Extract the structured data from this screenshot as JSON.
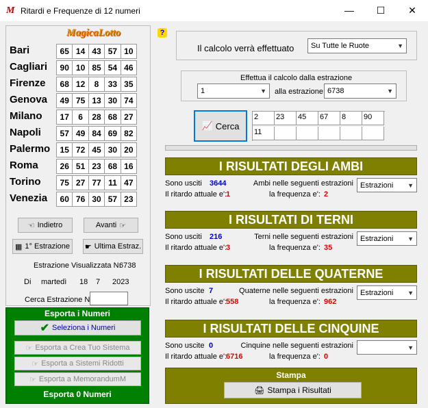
{
  "window": {
    "title": "Ritardi e Frequenze di 12 numeri",
    "icon": "magic-lotto-app-icon",
    "controls": [
      "—",
      "☐",
      "✕"
    ]
  },
  "logo": "MagicaLotto",
  "wheels": [
    {
      "name": "Bari",
      "numbers": [
        "65",
        "14",
        "43",
        "57",
        "10"
      ]
    },
    {
      "name": "Cagliari",
      "numbers": [
        "90",
        "10",
        "85",
        "54",
        "46"
      ]
    },
    {
      "name": "Firenze",
      "numbers": [
        "68",
        "12",
        "8",
        "33",
        "35"
      ]
    },
    {
      "name": "Genova",
      "numbers": [
        "49",
        "75",
        "13",
        "30",
        "74"
      ]
    },
    {
      "name": "Milano",
      "numbers": [
        "17",
        "6",
        "28",
        "68",
        "27"
      ]
    },
    {
      "name": "Napoli",
      "numbers": [
        "57",
        "49",
        "84",
        "69",
        "82"
      ]
    },
    {
      "name": "Palermo",
      "numbers": [
        "15",
        "72",
        "45",
        "30",
        "20"
      ]
    },
    {
      "name": "Roma",
      "numbers": [
        "26",
        "51",
        "23",
        "68",
        "16"
      ]
    },
    {
      "name": "Torino",
      "numbers": [
        "75",
        "27",
        "77",
        "11",
        "47"
      ]
    },
    {
      "name": "Venezia",
      "numbers": [
        "60",
        "76",
        "30",
        "57",
        "23"
      ]
    }
  ],
  "nav": {
    "back": "Indietro",
    "forward": "Avanti",
    "first": "1° Estrazione",
    "last": "Ultima Estraz.",
    "visualized_label": "Estrazione Visualizzata N:",
    "visualized_value": "6738",
    "di": "Di",
    "weekday": "martedì",
    "day": "18",
    "month": "7",
    "year": "2023",
    "search_label": "Cerca Estrazione N:",
    "search_value": ""
  },
  "export": {
    "title": "Esporta i Numeri",
    "select_btn": "Seleziona i Numeri",
    "btn1": "Esporta a Crea Tuo Sistema",
    "btn2": "Esporta a Sistemi Ridotti",
    "btn3": "Esporta a MemorandumM",
    "footer": "Esporta 0 Numeri"
  },
  "help_icon": "?",
  "calc": {
    "label": "Il calcolo verrà effettuato",
    "ruote_value": "Su Tutte le Ruote",
    "from_label": "Effettua il calcolo dalla estrazione",
    "from_value": "1",
    "to_label": "alla estrazione",
    "to_value": "6738"
  },
  "search_btn": "Cerca",
  "selected_numbers": [
    "2",
    "23",
    "45",
    "67",
    "8",
    "90",
    "11",
    "",
    "",
    "",
    "",
    ""
  ],
  "ambi": {
    "title": "I RISULTATI DEGLI AMBI",
    "usciti_label": "Sono usciti",
    "usciti": "3644",
    "ritardo_label": "Il ritardo attuale e':",
    "ritardo": "1",
    "next_label": "Ambi nelle seguenti estrazioni",
    "freq_label": "la frequenza e':",
    "freq": "2",
    "select": "Estrazioni"
  },
  "terni": {
    "title": "I RISULTATI DI TERNI",
    "usciti_label": "Sono usciti",
    "usciti": "216",
    "ritardo_label": "Il ritardo attuale e':",
    "ritardo": "3",
    "next_label": "Terni nelle seguenti estrazioni",
    "freq_label": "la frequenza e':",
    "freq": "35",
    "select": "Estrazioni"
  },
  "quaterne": {
    "title": "I RISULTATI DELLE QUATERNE",
    "usciti_label": "Sono uscite",
    "usciti": "7",
    "ritardo_label": "Il ritardo attuale e':",
    "ritardo": "558",
    "next_label": "Quaterne nelle seguenti estrazioni",
    "freq_label": "la frequenza e':",
    "freq": "962",
    "select": "Estrazioni"
  },
  "cinquine": {
    "title": "I RISULTATI DELLE CINQUINE",
    "usciti_label": "Sono uscite",
    "usciti": "0",
    "ritardo_label": "Il ritardo attuale e':",
    "ritardo": "6716",
    "next_label": "Cinquine nelle seguenti estrazioni",
    "freq_label": "la frequenza e':",
    "freq": "0",
    "select": ""
  },
  "stampa": {
    "title": "Stampa",
    "btn": "Stampa i Risultati"
  },
  "colors": {
    "olive": "#808000",
    "green": "#008000",
    "blue": "#0000c0",
    "red": "#e00000"
  }
}
